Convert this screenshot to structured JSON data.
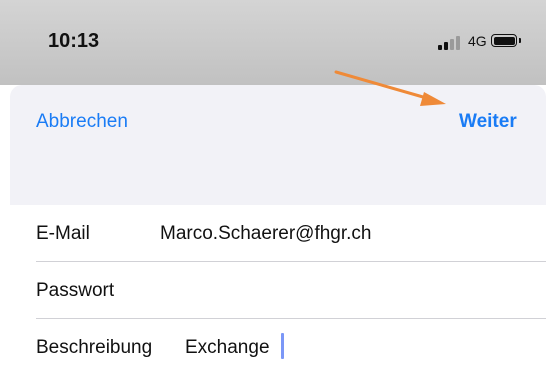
{
  "status_bar": {
    "time": "10:13",
    "network": "4G",
    "signal_icon": "cellular-signal-icon",
    "battery_icon": "battery-icon",
    "battery_level": 1.0
  },
  "nav": {
    "cancel_label": "Abbrechen",
    "next_label": "Weiter"
  },
  "form": {
    "email_label": "E-Mail",
    "email_value": "Marco.Schaerer@fhgr.ch",
    "password_label": "Passwort",
    "password_value": "",
    "description_label": "Beschreibung",
    "description_value": "Exchange"
  },
  "colors": {
    "accent": "#1a7cf5",
    "annotation_arrow": "#ef8a38",
    "sheet_background": "#f2f2f7",
    "status_background": "#c8c8c8"
  }
}
